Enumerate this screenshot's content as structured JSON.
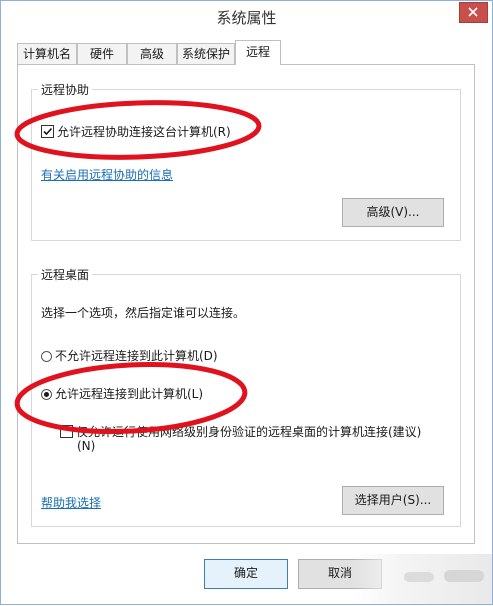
{
  "window": {
    "title": "系统属性"
  },
  "tabs": [
    {
      "label": "计算机名"
    },
    {
      "label": "硬件"
    },
    {
      "label": "高级"
    },
    {
      "label": "系统保护"
    },
    {
      "label": "远程",
      "active": true
    }
  ],
  "remote_assistance": {
    "group_label": "远程协助",
    "allow_checkbox_label": "允许远程协助连接这台计算机(R)",
    "allow_checked": true,
    "info_link": "有关启用远程协助的信息",
    "advanced_button": "高级(V)..."
  },
  "remote_desktop": {
    "group_label": "远程桌面",
    "instruction": "选择一个选项，然后指定谁可以连接。",
    "options": [
      {
        "label": "不允许远程连接到此计算机(D)",
        "selected": false
      },
      {
        "label": "允许远程连接到此计算机(L)",
        "selected": true
      }
    ],
    "nla_label": "仅允许运行使用网络级别身份验证的远程桌面的计算机连接(建议)",
    "nla_label_line2": "(N)",
    "nla_checked": false,
    "help_link": "帮助我选择",
    "select_users_button": "选择用户(S)..."
  },
  "footer": {
    "ok_button": "确定",
    "cancel_button": "取消"
  },
  "colors": {
    "annotation": "#e0121e",
    "link": "#1a6fb5",
    "close_button": "#c7504c"
  }
}
